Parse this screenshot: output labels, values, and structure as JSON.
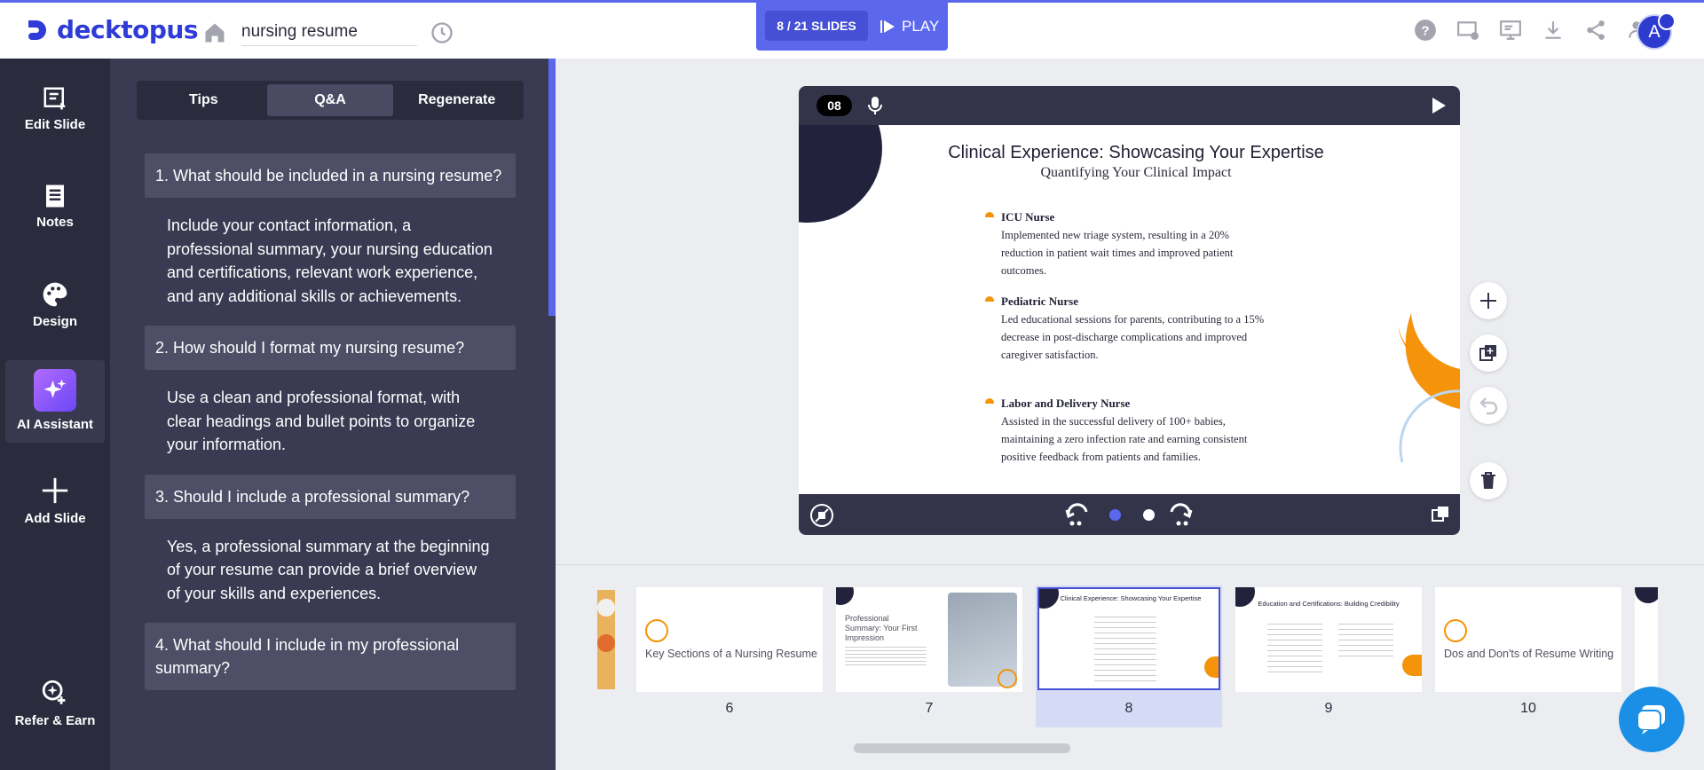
{
  "app": {
    "name": "decktopus",
    "doc_title": "nursing resume"
  },
  "header": {
    "slide_counter": "8 / 21 SLIDES",
    "play_label": "PLAY",
    "avatar_letter": "A"
  },
  "leftnav": {
    "items": [
      {
        "label": "Edit Slide",
        "icon": "edit-slide-icon"
      },
      {
        "label": "Notes",
        "icon": "notes-icon"
      },
      {
        "label": "Design",
        "icon": "palette-icon"
      },
      {
        "label": "AI Assistant",
        "icon": "sparkle-icon"
      },
      {
        "label": "Add Slide",
        "icon": "plus-icon"
      },
      {
        "label": "Refer & Earn",
        "icon": "refer-icon"
      }
    ]
  },
  "panel": {
    "tabs": [
      "Tips",
      "Q&A",
      "Regenerate"
    ],
    "qa": [
      {
        "q": "1. What should be included in a nursing resume?",
        "a": "Include your contact information, a professional summary, your nursing education and certifications, relevant work experience, and any additional skills or achievements."
      },
      {
        "q": "2. How should I format my nursing resume?",
        "a": "Use a clean and professional format, with clear headings and bullet points to organize your information."
      },
      {
        "q": "3. Should I include a professional summary?",
        "a": "Yes, a professional summary at the beginning of your resume can provide a brief overview of your skills and experiences."
      },
      {
        "q": "4. What should I include in my professional summary?",
        "a": ""
      }
    ]
  },
  "slide": {
    "number": "08",
    "title": "Clinical Experience: Showcasing Your Expertise",
    "subtitle": "Quantifying Your Clinical Impact",
    "items": [
      {
        "title": "ICU Nurse",
        "desc": "Implemented new triage system, resulting in a 20% reduction in patient wait times and improved patient outcomes."
      },
      {
        "title": "Pediatric Nurse",
        "desc": "Led educational sessions for parents, contributing to a 15% decrease in post-discharge complications and improved caregiver satisfaction."
      },
      {
        "title": "Labor and Delivery Nurse",
        "desc": "Assisted in the successful delivery of 100+ babies, maintaining a zero infection rate and earning consistent positive feedback from patients and families."
      }
    ],
    "accent_color": "#f5930a",
    "dark_color": "#23223d"
  },
  "filmstrip": {
    "thumbs": [
      {
        "num": "6",
        "caption": "Key Sections of a Nursing Resume"
      },
      {
        "num": "7",
        "caption": "Professional Summary: Your First Impression"
      },
      {
        "num": "8",
        "caption": "Clinical Experience: Showcasing Your Expertise"
      },
      {
        "num": "9",
        "caption": "Education and Certifications: Building Credibility"
      },
      {
        "num": "10",
        "caption": "Dos and Don'ts of Resume Writing"
      }
    ],
    "selected": "8"
  },
  "colors": {
    "brand": "#2e3bd7",
    "accent": "#5b68ee",
    "panel": "#3a3b52",
    "nav": "#2a2b3d"
  }
}
